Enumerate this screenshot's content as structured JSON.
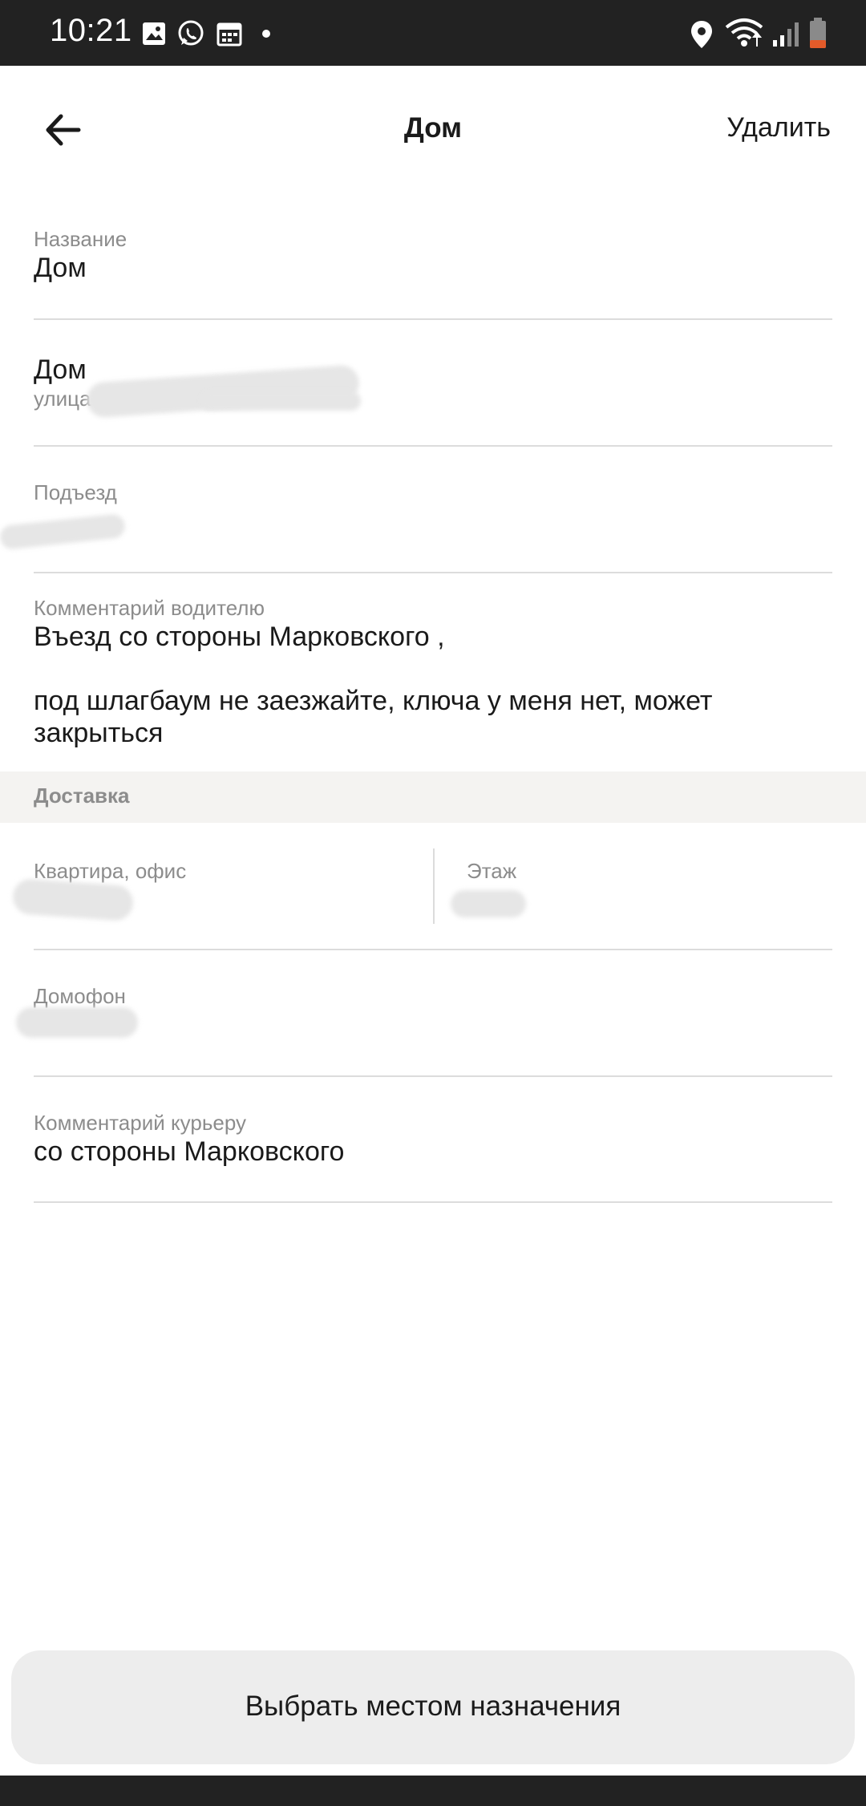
{
  "status_bar": {
    "time": "10:21",
    "left_icons": [
      "image-icon",
      "whatsapp-icon",
      "calendar-icon",
      "dot-icon"
    ],
    "right_icons": [
      "location-icon",
      "wifi-icon",
      "signal-icon",
      "battery-low-icon"
    ]
  },
  "app_bar": {
    "back_icon": "arrow-left-icon",
    "title": "Дом",
    "delete_label": "Удалить"
  },
  "fields": {
    "name": {
      "label": "Название",
      "value": "Дом"
    },
    "address": {
      "title": "Дом",
      "subtitle": "улица"
    },
    "entrance": {
      "label": "Подъезд"
    },
    "driver_comment": {
      "label": "Комментарий водителю",
      "value": "Въезд со стороны Марковского ,\n\nпод шлагбаум не заезжайте, ключа у меня нет,  может закрыться"
    }
  },
  "delivery": {
    "section_title": "Доставка",
    "apartment": {
      "label": "Квартира, офис"
    },
    "floor": {
      "label": "Этаж"
    },
    "intercom": {
      "label": "Домофон"
    },
    "courier_comment": {
      "label": "Комментарий курьеру",
      "value": "со стороны Марковского"
    }
  },
  "cta": {
    "label": "Выбрать местом назначения"
  }
}
